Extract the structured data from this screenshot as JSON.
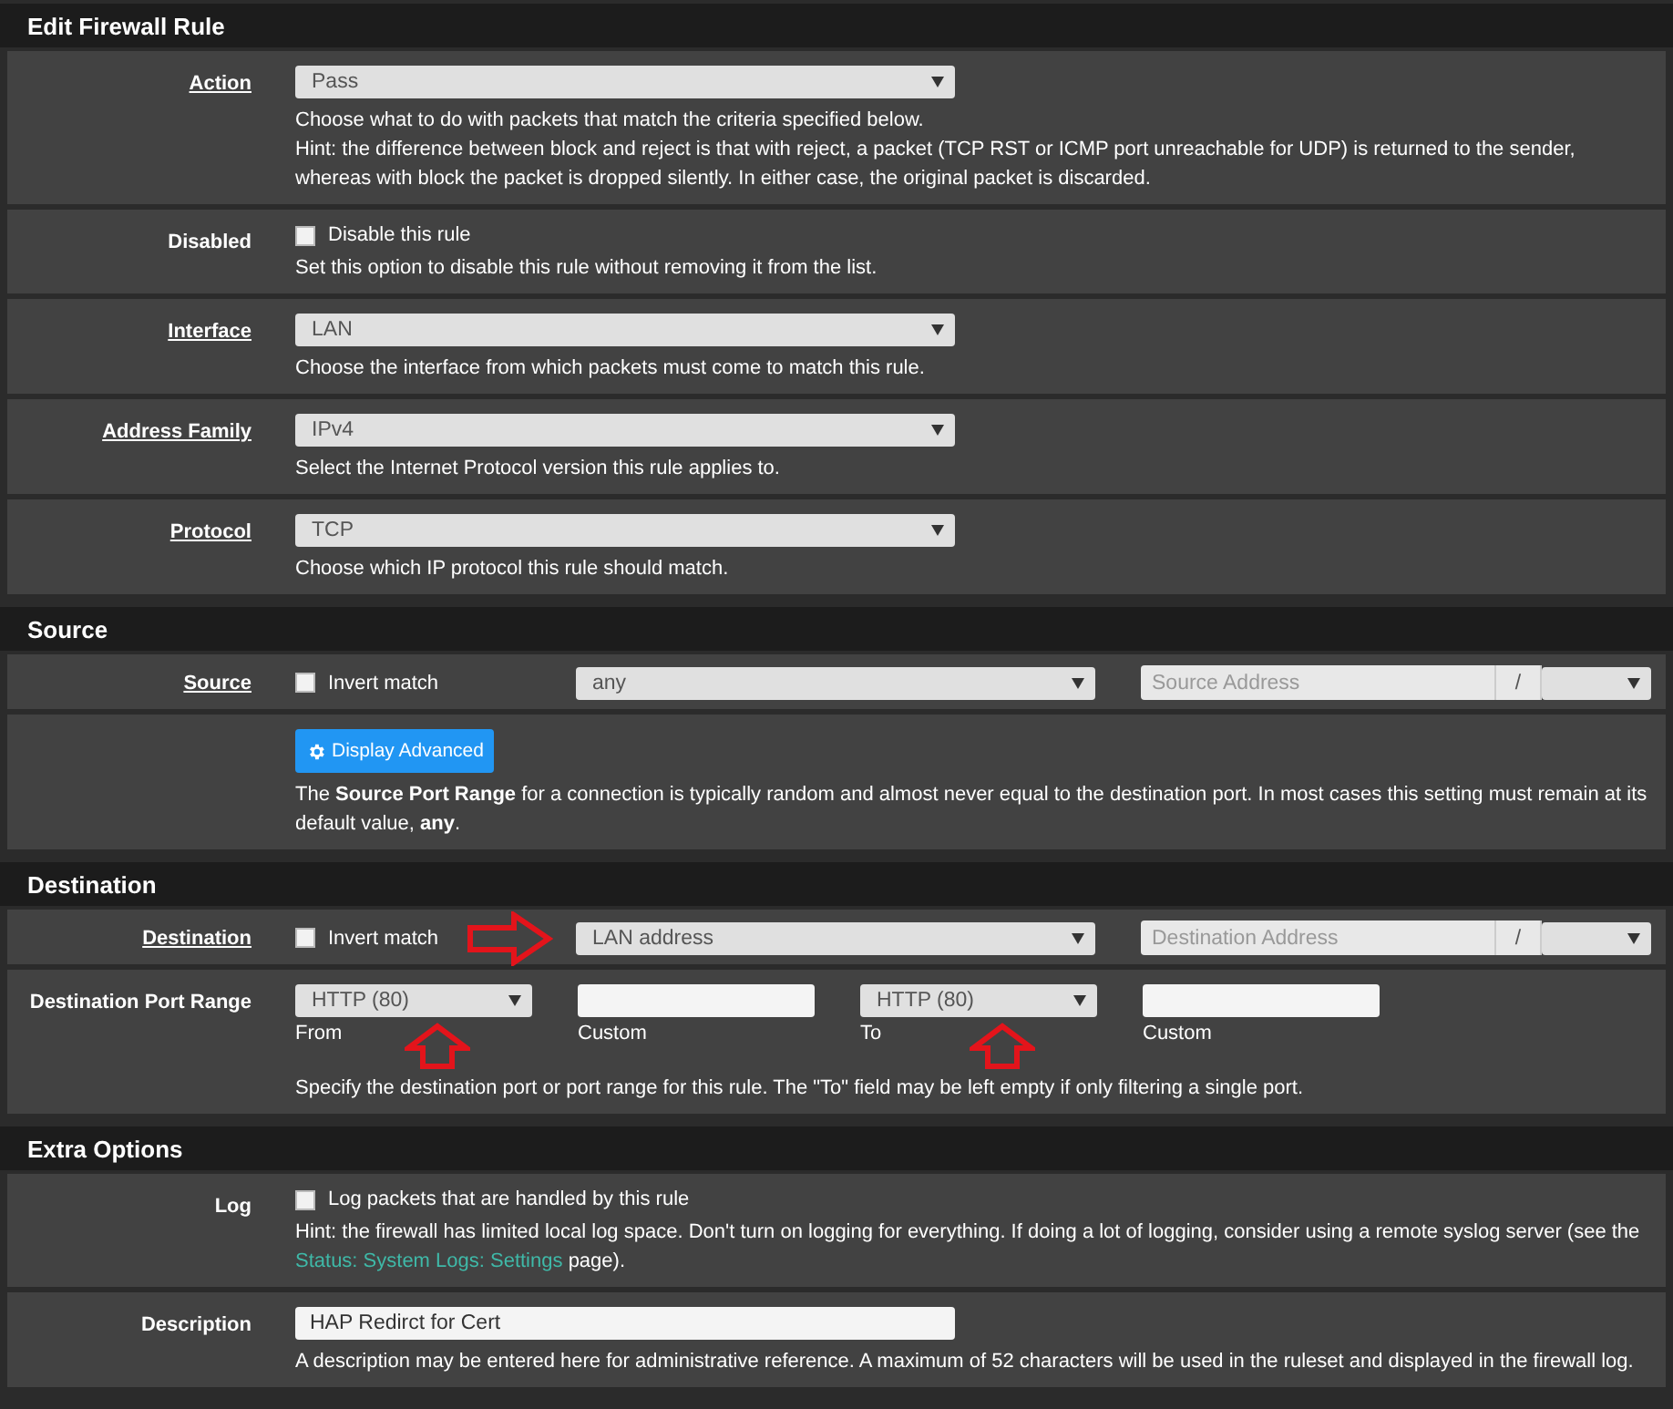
{
  "sections": [
    {
      "title": "Edit Firewall Rule",
      "rows": [
        {
          "kind": "select",
          "label": "Action",
          "link": true,
          "value": "Pass",
          "help": [
            "Choose what to do with packets that match the criteria specified below.",
            "Hint: the difference between block and reject is that with reject, a packet (TCP RST or ICMP port unreachable for UDP) is returned to the sender, whereas with block the packet is dropped silently. In either case, the original packet is discarded."
          ]
        },
        {
          "kind": "checkbox",
          "label": "Disabled",
          "link": false,
          "checkbox_label": "Disable this rule",
          "checked": false,
          "help": [
            "Set this option to disable this rule without removing it from the list."
          ]
        },
        {
          "kind": "select",
          "label": "Interface",
          "link": true,
          "value": "LAN",
          "help": [
            "Choose the interface from which packets must come to match this rule."
          ]
        },
        {
          "kind": "select",
          "label": "Address Family",
          "link": true,
          "value": "IPv4",
          "help": [
            "Select the Internet Protocol version this rule applies to."
          ]
        },
        {
          "kind": "select",
          "label": "Protocol",
          "link": true,
          "value": "TCP",
          "help": [
            "Choose which IP protocol this rule should match."
          ]
        }
      ]
    },
    {
      "title": "Source",
      "rows": [
        {
          "kind": "address",
          "label": "Source",
          "link": true,
          "invert_label": "Invert match",
          "checked": false,
          "type": "any",
          "placeholder": "Source Address",
          "slash": "/",
          "arrow": false
        },
        {
          "kind": "advanced",
          "button": "Display Advanced",
          "help": [
            "The **Source Port Range** for a connection is typically random and almost never equal to the destination port. In most cases this setting must remain at its default value, **any**."
          ]
        }
      ]
    },
    {
      "title": "Destination",
      "rows": [
        {
          "kind": "address",
          "label": "Destination",
          "link": true,
          "invert_label": "Invert match",
          "checked": false,
          "type": "LAN address",
          "placeholder": "Destination Address",
          "slash": "/",
          "arrow": true
        },
        {
          "kind": "ports",
          "label": "Destination Port Range",
          "link": false,
          "fields": [
            {
              "kind": "select",
              "value": "HTTP (80)",
              "caption": "From",
              "arrow": true
            },
            {
              "kind": "input",
              "caption": "Custom",
              "arrow": false
            },
            {
              "kind": "select",
              "value": "HTTP (80)",
              "caption": "To",
              "arrow": true
            },
            {
              "kind": "input",
              "caption": "Custom",
              "arrow": false
            }
          ],
          "help": [
            "Specify the destination port or port range for this rule. The \"To\" field may be left empty if only filtering a single port."
          ]
        }
      ]
    },
    {
      "title": "Extra Options",
      "rows": [
        {
          "kind": "checkbox",
          "label": "Log",
          "link": false,
          "checkbox_label": "Log packets that are handled by this rule",
          "checked": false,
          "help_link": {
            "before": "Hint: the firewall has limited local log space. Don't turn on logging for everything. If doing a lot of logging, consider using a remote syslog server (see the",
            "link": "Status: System Logs: Settings",
            "after": "page)."
          }
        },
        {
          "kind": "text",
          "label": "Description",
          "link": false,
          "value": "HAP Redirct for Cert",
          "help": [
            "A description may be entered here for administrative reference. A maximum of 52 characters will be used in the ruleset and displayed in the firewall log."
          ]
        }
      ]
    }
  ]
}
